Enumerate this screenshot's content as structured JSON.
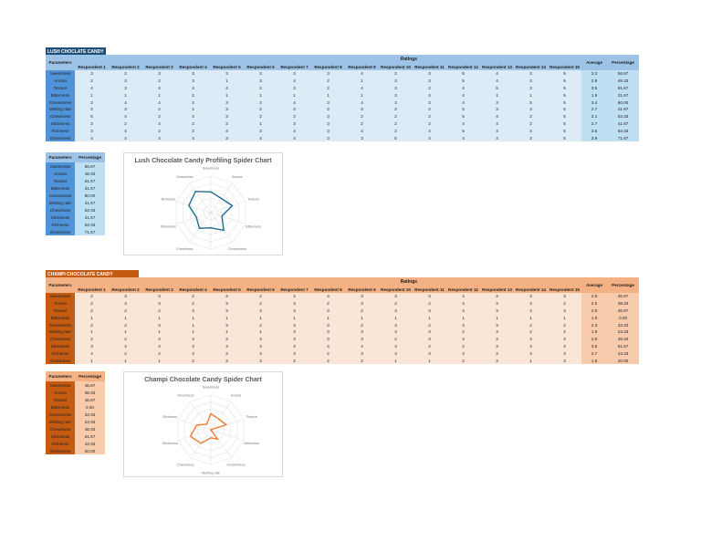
{
  "sheets": [
    {
      "key": "lush",
      "title": "LUSH CHOCLATE CANDY",
      "chart_title": "Lush Chocolate Candy Profiling Spider Chart",
      "colors": {
        "label": "#1f4e79",
        "param": "#4f93d8",
        "head": "#9dc3e6",
        "body": "#ddebf7",
        "avg": "#bfe0f3",
        "line": "#1f6e91",
        "pctbody": "#bfe0f3"
      },
      "ratings": [
        {
          "param": "Sweetness",
          "values": [
            3,
            2,
            3,
            3,
            3,
            3,
            3,
            3,
            4,
            2,
            3,
            5,
            4,
            3,
            5
          ],
          "average": "3.3",
          "percentage": "56.67"
        },
        {
          "param": "Aroma",
          "values": [
            2,
            3,
            2,
            3,
            1,
            3,
            4,
            2,
            1,
            3,
            3,
            5,
            4,
            3,
            5
          ],
          "average": "2.9",
          "percentage": "48.33"
        },
        {
          "param": "Texture",
          "values": [
            4,
            3,
            4,
            4,
            4,
            2,
            3,
            2,
            4,
            3,
            2,
            4,
            5,
            3,
            5
          ],
          "average": "3.5",
          "percentage": "61.67"
        },
        {
          "param": "Bitterness",
          "values": [
            1,
            1,
            1,
            2,
            1,
            1,
            1,
            1,
            1,
            3,
            4,
            4,
            1,
            1,
            5
          ],
          "average": "1.9",
          "percentage": "31.67"
        },
        {
          "param": "Creaminess",
          "values": [
            2,
            4,
            4,
            2,
            3,
            2,
            4,
            3,
            4,
            3,
            3,
            4,
            3,
            5,
            5
          ],
          "average": "3.4",
          "percentage": "60.00"
        },
        {
          "param": "Melting rate",
          "values": [
            2,
            3,
            2,
            1,
            3,
            2,
            3,
            2,
            3,
            2,
            2,
            5,
            3,
            3,
            5
          ],
          "average": "2.7",
          "percentage": "41.67"
        },
        {
          "param": "Chewiness",
          "values": [
            5,
            4,
            2,
            4,
            3,
            2,
            2,
            3,
            2,
            2,
            2,
            5,
            4,
            2,
            5
          ],
          "average": "3.1",
          "percentage": "53.33"
        },
        {
          "param": "Stickiness",
          "values": [
            2,
            2,
            4,
            2,
            2,
            1,
            3,
            3,
            2,
            2,
            2,
            4,
            4,
            2,
            5
          ],
          "average": "2.7",
          "percentage": "41.67"
        },
        {
          "param": "Richness",
          "values": [
            3,
            4,
            2,
            2,
            4,
            3,
            4,
            3,
            4,
            2,
            4,
            5,
            4,
            4,
            5
          ],
          "average": "3.5",
          "percentage": "63.33"
        },
        {
          "param": "Glossiness",
          "values": [
            4,
            4,
            4,
            4,
            3,
            4,
            4,
            3,
            3,
            5,
            4,
            4,
            4,
            3,
            5
          ],
          "average": "3.9",
          "percentage": "71.67"
        }
      ]
    },
    {
      "key": "champi",
      "title": "CHAMPI CHOCOLATE CANDY",
      "chart_title": "Champi Chocolate Candy Spider Chart",
      "colors": {
        "label": "#c55a11",
        "param": "#c55a11",
        "head": "#f4b183",
        "body": "#fbe5d6",
        "avg": "#f8cbad",
        "line": "#ed7d31",
        "pctbody": "#f8cbad"
      },
      "ratings": [
        {
          "param": "Sweetness",
          "values": [
            2,
            3,
            3,
            2,
            2,
            2,
            4,
            4,
            3,
            3,
            3,
            4,
            2,
            3,
            3
          ],
          "average": "2.9",
          "percentage": "46.67"
        },
        {
          "param": "Aroma",
          "values": [
            2,
            3,
            3,
            2,
            3,
            2,
            3,
            2,
            3,
            2,
            2,
            4,
            2,
            3,
            2
          ],
          "average": "2.5",
          "percentage": "38.33"
        },
        {
          "param": "Texture",
          "values": [
            2,
            2,
            2,
            3,
            3,
            3,
            3,
            3,
            2,
            3,
            3,
            4,
            3,
            4,
            3
          ],
          "average": "2.9",
          "percentage": "46.67"
        },
        {
          "param": "Bitterness",
          "values": [
            1,
            1,
            1,
            1,
            1,
            1,
            1,
            1,
            1,
            1,
            1,
            1,
            1,
            1,
            1
          ],
          "average": "1.0",
          "percentage": "0.00"
        },
        {
          "param": "Creaminess",
          "values": [
            2,
            2,
            3,
            1,
            3,
            2,
            3,
            3,
            2,
            3,
            2,
            3,
            3,
            2,
            2
          ],
          "average": "2.3",
          "percentage": "33.33"
        },
        {
          "param": "Melting rate",
          "values": [
            1,
            1,
            1,
            1,
            1,
            1,
            3,
            3,
            3,
            3,
            3,
            2,
            4,
            2,
            2
          ],
          "average": "1.9",
          "percentage": "23.33"
        },
        {
          "param": "Chewiness",
          "values": [
            2,
            2,
            4,
            4,
            2,
            3,
            3,
            3,
            3,
            2,
            3,
            4,
            2,
            4,
            4
          ],
          "average": "2.9",
          "percentage": "48.33"
        },
        {
          "param": "Stickiness",
          "values": [
            3,
            4,
            4,
            3,
            4,
            4,
            4,
            4,
            4,
            3,
            2,
            2,
            3,
            4,
            4
          ],
          "average": "3.5",
          "percentage": "61.67"
        },
        {
          "param": "Richness",
          "values": [
            4,
            2,
            2,
            3,
            2,
            3,
            3,
            2,
            3,
            3,
            3,
            3,
            2,
            3,
            3
          ],
          "average": "2.7",
          "percentage": "43.33"
        },
        {
          "param": "Glossiness",
          "values": [
            1,
            1,
            1,
            2,
            2,
            3,
            2,
            2,
            2,
            1,
            1,
            2,
            3,
            1,
            3
          ],
          "average": "1.8",
          "percentage": "20.00"
        }
      ]
    }
  ],
  "headers": {
    "parameters": "Parameters",
    "ratings": "Ratings",
    "average": "Average",
    "percentage": "Percentage",
    "respondents": [
      "Respondent 1",
      "Respondent 2",
      "Respondent 3",
      "Respondent 4",
      "Respondent 5",
      "Respondent 6",
      "Respondent 7",
      "Respondent 8",
      "Respondent 9",
      "Respondent 10",
      "Respondent 11",
      "Respondent 12",
      "Respondent 13",
      "Respondent 14",
      "Respondent 15"
    ]
  }
}
